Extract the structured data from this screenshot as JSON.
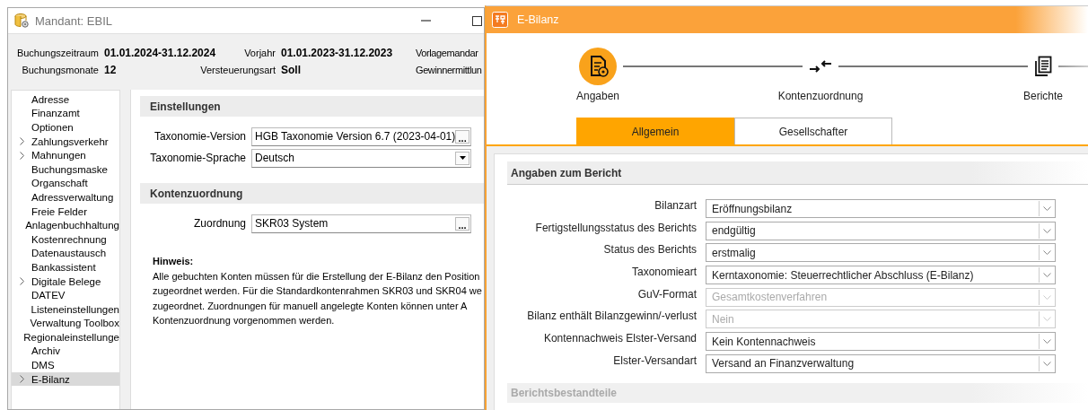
{
  "mandant_window": {
    "title": "Mandant: EBIL",
    "header_rows": [
      [
        {
          "label": "Buchungszeitraum",
          "value": "01.01.2024-31.12.2024"
        },
        {
          "label": "Vorjahr",
          "value": "01.01.2023-31.12.2023"
        },
        {
          "label": "Vorlagemandar"
        }
      ],
      [
        {
          "label": "Buchungsmonate",
          "value": "12"
        },
        {
          "label": "Versteuerungsart",
          "value": "Soll"
        },
        {
          "label": "Gewinnermittlun"
        }
      ]
    ],
    "sidebar": {
      "items": [
        {
          "label": "Adresse",
          "has_children": false,
          "selected": false
        },
        {
          "label": "Finanzamt",
          "has_children": false,
          "selected": false
        },
        {
          "label": "Optionen",
          "has_children": false,
          "selected": false
        },
        {
          "label": "Zahlungsverkehr",
          "has_children": true,
          "selected": false
        },
        {
          "label": "Mahnungen",
          "has_children": true,
          "selected": false
        },
        {
          "label": "Buchungsmaske",
          "has_children": false,
          "selected": false
        },
        {
          "label": "Organschaft",
          "has_children": false,
          "selected": false
        },
        {
          "label": "Adressverwaltung",
          "has_children": false,
          "selected": false
        },
        {
          "label": "Freie Felder",
          "has_children": false,
          "selected": false
        },
        {
          "label": "Anlagenbuchhaltung",
          "has_children": false,
          "selected": false
        },
        {
          "label": "Kostenrechnung",
          "has_children": false,
          "selected": false
        },
        {
          "label": "Datenaustausch",
          "has_children": false,
          "selected": false
        },
        {
          "label": "Bankassistent",
          "has_children": false,
          "selected": false
        },
        {
          "label": "Digitale Belege",
          "has_children": true,
          "selected": false
        },
        {
          "label": "DATEV",
          "has_children": false,
          "selected": false
        },
        {
          "label": "Listeneinstellungen",
          "has_children": false,
          "selected": false
        },
        {
          "label": "Verwaltung Toolbox",
          "has_children": false,
          "selected": false
        },
        {
          "label": "Regionaleinstellunge",
          "has_children": false,
          "selected": false
        },
        {
          "label": "Archiv",
          "has_children": false,
          "selected": false
        },
        {
          "label": "DMS",
          "has_children": false,
          "selected": false
        },
        {
          "label": "E-Bilanz",
          "has_children": true,
          "selected": true
        }
      ]
    },
    "sections": [
      {
        "title": "Einstellungen",
        "fields": [
          {
            "label": "Taxonomie-Version",
            "value": "HGB Taxonomie Version 6.7 (2023-04-01)",
            "kind": "browse",
            "button_text": "..."
          },
          {
            "label": "Taxonomie-Sprache",
            "value": "Deutsch",
            "kind": "dropdown"
          }
        ]
      },
      {
        "title": "Kontenzuordnung",
        "fields": [
          {
            "label": "Zuordnung",
            "value": "SKR03 System",
            "kind": "browse",
            "button_text": "..."
          }
        ]
      }
    ],
    "hint": {
      "title": "Hinweis:",
      "lines": [
        "Alle gebuchten Konten müssen für die Erstellung der E-Bilanz den Position",
        "zugeordnet werden. Für die Standardkontenrahmen SKR03 und SKR04 we",
        "zugeordnet. Zuordnungen für manuell angelegte Konten können unter A",
        "Kontenzuordnung vorgenommen werden."
      ]
    }
  },
  "ebilanz_window": {
    "title": "E-Bilanz",
    "steps": [
      {
        "label": "Angaben",
        "active": true,
        "kind": "document"
      },
      {
        "label": "Kontenzuordnung",
        "active": false,
        "kind": "arrows"
      },
      {
        "label": "Berichte",
        "active": false,
        "kind": "pages"
      }
    ],
    "tabs": [
      {
        "label": "Allgemein",
        "selected": true
      },
      {
        "label": "Gesellschafter",
        "selected": false
      }
    ],
    "section": {
      "title": "Angaben zum Bericht",
      "fields": [
        {
          "label": "Bilanzart",
          "value": "Eröffnungsbilanz",
          "disabled": false
        },
        {
          "label": "Fertigstellungsstatus des Berichts",
          "value": "endgültig",
          "disabled": false
        },
        {
          "label": "Status des Berichts",
          "value": "erstmalig",
          "disabled": false
        },
        {
          "label": "Taxonomieart",
          "value": "Kerntaxonomie: Steuerrechtlicher Abschluss (E-Bilanz)",
          "disabled": false
        },
        {
          "label": "GuV-Format",
          "value": "Gesamtkostenverfahren",
          "disabled": true
        },
        {
          "label": "Bilanz enthält Bilanzgewinn/-verlust",
          "value": "Nein",
          "disabled": true
        },
        {
          "label": "Kontennachweis Elster-Versand",
          "value": "Kein Kontennachweis",
          "disabled": false
        },
        {
          "label": "Elster-Versandart",
          "value": "Versand an Finanzverwaltung",
          "disabled": false
        }
      ]
    },
    "next_section": {
      "title": "Berichtsbestandteile"
    }
  }
}
